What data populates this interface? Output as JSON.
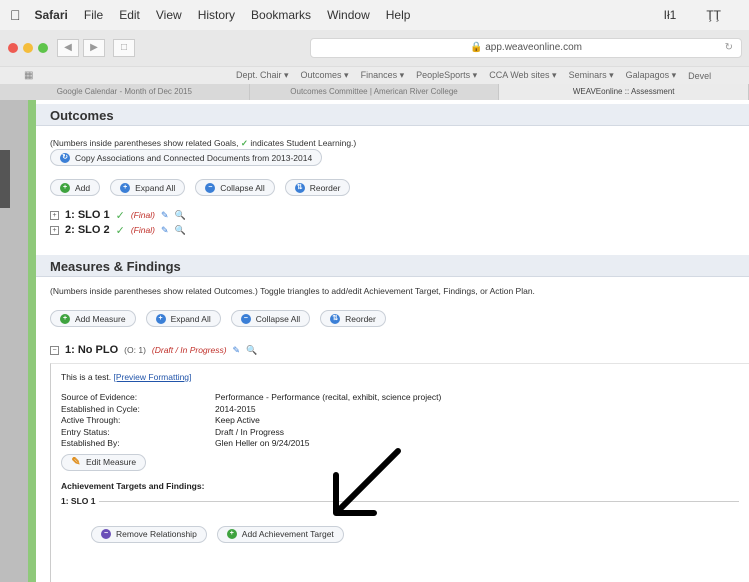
{
  "menubar": {
    "apple_icon": "apple-logo-icon",
    "items": [
      "Safari",
      "File",
      "Edit",
      "View",
      "History",
      "Bookmarks",
      "Window",
      "Help"
    ],
    "right_items": [
      "Ił1",
      "ŢŢ"
    ]
  },
  "toolbar": {
    "url": "app.weaveonline.com",
    "url_lock_icon": "lock-icon",
    "reload_icon": "reload-icon"
  },
  "bookmarks": [
    "Dept. Chair ▾",
    "Outcomes ▾",
    "Finances ▾",
    "PeopleSports ▾",
    "CCA Web sites ▾",
    "Seminars ▾",
    "Galapagos ▾",
    "Devel"
  ],
  "tabs": [
    "Google Calendar - Month of Dec 2015",
    "Outcomes Committee | American River College",
    "WEAVEonline :: Assessment"
  ],
  "outcomes": {
    "heading": "Outcomes",
    "note_prefix": "(Numbers inside parentheses show related Goals,",
    "note_suffix": "indicates Student Learning.)",
    "copy_label": "Copy Associations and Connected Documents from 2013-2014",
    "buttons": [
      "Add",
      "Expand All",
      "Collapse All",
      "Reorder"
    ],
    "items": [
      {
        "label": "1: SLO 1",
        "status": "(Final)"
      },
      {
        "label": "2: SLO 2",
        "status": "(Final)"
      }
    ]
  },
  "measures": {
    "heading": "Measures & Findings",
    "note": "(Numbers inside parentheses show related Outcomes.) Toggle triangles to add/edit Achievement Target, Findings, or Action Plan.",
    "buttons": [
      "Add Measure",
      "Expand All",
      "Collapse All",
      "Reorder"
    ],
    "item": {
      "title": "1: No PLO",
      "ref": "(O: 1)",
      "status": "(Draft / In Progress)",
      "desc": "This is a test.",
      "preview_link": "[Preview Formatting]",
      "fields": [
        {
          "k": "Source of Evidence:",
          "v": "Performance - Performance (recital, exhibit, science project)"
        },
        {
          "k": "Established in Cycle:",
          "v": "2014-2015"
        },
        {
          "k": "Active Through:",
          "v": "Keep Active"
        },
        {
          "k": "Entry Status:",
          "v": "Draft / In Progress"
        },
        {
          "k": "Established By:",
          "v": "Glen Heller on 9/24/2015"
        }
      ],
      "edit_label": "Edit Measure",
      "targets_heading": "Achievement Targets and Findings:",
      "target_label": "1: SLO 1",
      "remove_label": "Remove Relationship",
      "add_target_label": "Add Achievement Target"
    }
  },
  "colors": {
    "accent_blue": "#3b7fd6",
    "green": "#3fa33f",
    "draft_red": "#c0302a",
    "sidebar_green": "#8fc97a"
  }
}
